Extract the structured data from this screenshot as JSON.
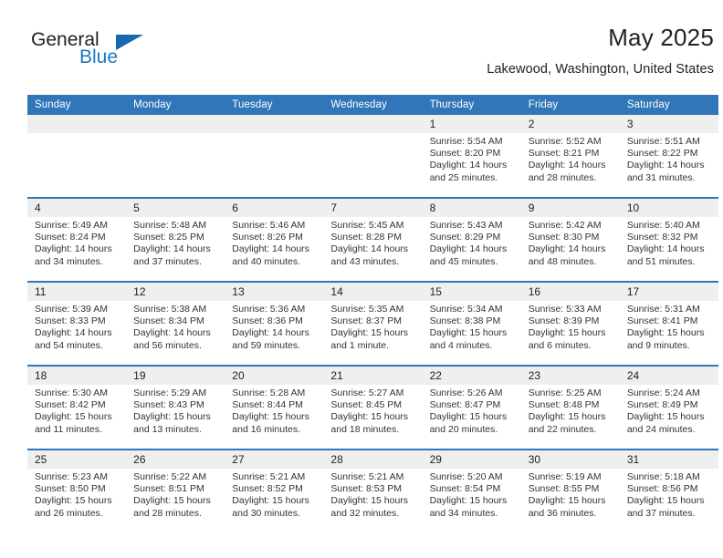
{
  "brand": {
    "name_part1": "General",
    "name_part2": "Blue",
    "triangle_color": "#1668b0",
    "blue_text_color": "#1b79c2"
  },
  "header": {
    "title": "May 2025",
    "location": "Lakewood, Washington, United States",
    "header_bg_color": "#3076b8",
    "daynum_bg_color": "#efefef"
  },
  "weekday_headers": [
    "Sunday",
    "Monday",
    "Tuesday",
    "Wednesday",
    "Thursday",
    "Friday",
    "Saturday"
  ],
  "labels": {
    "sunrise_prefix": "Sunrise:",
    "sunset_prefix": "Sunset:",
    "daylight_prefix": "Daylight:"
  },
  "weeks": [
    [
      {
        "day": "",
        "empty": true
      },
      {
        "day": "",
        "empty": true
      },
      {
        "day": "",
        "empty": true
      },
      {
        "day": "",
        "empty": true
      },
      {
        "day": "1",
        "sunrise": "Sunrise: 5:54 AM",
        "sunset": "Sunset: 8:20 PM",
        "daylight_line1": "Daylight: 14 hours",
        "daylight_line2": "and 25 minutes."
      },
      {
        "day": "2",
        "sunrise": "Sunrise: 5:52 AM",
        "sunset": "Sunset: 8:21 PM",
        "daylight_line1": "Daylight: 14 hours",
        "daylight_line2": "and 28 minutes."
      },
      {
        "day": "3",
        "sunrise": "Sunrise: 5:51 AM",
        "sunset": "Sunset: 8:22 PM",
        "daylight_line1": "Daylight: 14 hours",
        "daylight_line2": "and 31 minutes."
      }
    ],
    [
      {
        "day": "4",
        "sunrise": "Sunrise: 5:49 AM",
        "sunset": "Sunset: 8:24 PM",
        "daylight_line1": "Daylight: 14 hours",
        "daylight_line2": "and 34 minutes."
      },
      {
        "day": "5",
        "sunrise": "Sunrise: 5:48 AM",
        "sunset": "Sunset: 8:25 PM",
        "daylight_line1": "Daylight: 14 hours",
        "daylight_line2": "and 37 minutes."
      },
      {
        "day": "6",
        "sunrise": "Sunrise: 5:46 AM",
        "sunset": "Sunset: 8:26 PM",
        "daylight_line1": "Daylight: 14 hours",
        "daylight_line2": "and 40 minutes."
      },
      {
        "day": "7",
        "sunrise": "Sunrise: 5:45 AM",
        "sunset": "Sunset: 8:28 PM",
        "daylight_line1": "Daylight: 14 hours",
        "daylight_line2": "and 43 minutes."
      },
      {
        "day": "8",
        "sunrise": "Sunrise: 5:43 AM",
        "sunset": "Sunset: 8:29 PM",
        "daylight_line1": "Daylight: 14 hours",
        "daylight_line2": "and 45 minutes."
      },
      {
        "day": "9",
        "sunrise": "Sunrise: 5:42 AM",
        "sunset": "Sunset: 8:30 PM",
        "daylight_line1": "Daylight: 14 hours",
        "daylight_line2": "and 48 minutes."
      },
      {
        "day": "10",
        "sunrise": "Sunrise: 5:40 AM",
        "sunset": "Sunset: 8:32 PM",
        "daylight_line1": "Daylight: 14 hours",
        "daylight_line2": "and 51 minutes."
      }
    ],
    [
      {
        "day": "11",
        "sunrise": "Sunrise: 5:39 AM",
        "sunset": "Sunset: 8:33 PM",
        "daylight_line1": "Daylight: 14 hours",
        "daylight_line2": "and 54 minutes."
      },
      {
        "day": "12",
        "sunrise": "Sunrise: 5:38 AM",
        "sunset": "Sunset: 8:34 PM",
        "daylight_line1": "Daylight: 14 hours",
        "daylight_line2": "and 56 minutes."
      },
      {
        "day": "13",
        "sunrise": "Sunrise: 5:36 AM",
        "sunset": "Sunset: 8:36 PM",
        "daylight_line1": "Daylight: 14 hours",
        "daylight_line2": "and 59 minutes."
      },
      {
        "day": "14",
        "sunrise": "Sunrise: 5:35 AM",
        "sunset": "Sunset: 8:37 PM",
        "daylight_line1": "Daylight: 15 hours",
        "daylight_line2": "and 1 minute."
      },
      {
        "day": "15",
        "sunrise": "Sunrise: 5:34 AM",
        "sunset": "Sunset: 8:38 PM",
        "daylight_line1": "Daylight: 15 hours",
        "daylight_line2": "and 4 minutes."
      },
      {
        "day": "16",
        "sunrise": "Sunrise: 5:33 AM",
        "sunset": "Sunset: 8:39 PM",
        "daylight_line1": "Daylight: 15 hours",
        "daylight_line2": "and 6 minutes."
      },
      {
        "day": "17",
        "sunrise": "Sunrise: 5:31 AM",
        "sunset": "Sunset: 8:41 PM",
        "daylight_line1": "Daylight: 15 hours",
        "daylight_line2": "and 9 minutes."
      }
    ],
    [
      {
        "day": "18",
        "sunrise": "Sunrise: 5:30 AM",
        "sunset": "Sunset: 8:42 PM",
        "daylight_line1": "Daylight: 15 hours",
        "daylight_line2": "and 11 minutes."
      },
      {
        "day": "19",
        "sunrise": "Sunrise: 5:29 AM",
        "sunset": "Sunset: 8:43 PM",
        "daylight_line1": "Daylight: 15 hours",
        "daylight_line2": "and 13 minutes."
      },
      {
        "day": "20",
        "sunrise": "Sunrise: 5:28 AM",
        "sunset": "Sunset: 8:44 PM",
        "daylight_line1": "Daylight: 15 hours",
        "daylight_line2": "and 16 minutes."
      },
      {
        "day": "21",
        "sunrise": "Sunrise: 5:27 AM",
        "sunset": "Sunset: 8:45 PM",
        "daylight_line1": "Daylight: 15 hours",
        "daylight_line2": "and 18 minutes."
      },
      {
        "day": "22",
        "sunrise": "Sunrise: 5:26 AM",
        "sunset": "Sunset: 8:47 PM",
        "daylight_line1": "Daylight: 15 hours",
        "daylight_line2": "and 20 minutes."
      },
      {
        "day": "23",
        "sunrise": "Sunrise: 5:25 AM",
        "sunset": "Sunset: 8:48 PM",
        "daylight_line1": "Daylight: 15 hours",
        "daylight_line2": "and 22 minutes."
      },
      {
        "day": "24",
        "sunrise": "Sunrise: 5:24 AM",
        "sunset": "Sunset: 8:49 PM",
        "daylight_line1": "Daylight: 15 hours",
        "daylight_line2": "and 24 minutes."
      }
    ],
    [
      {
        "day": "25",
        "sunrise": "Sunrise: 5:23 AM",
        "sunset": "Sunset: 8:50 PM",
        "daylight_line1": "Daylight: 15 hours",
        "daylight_line2": "and 26 minutes."
      },
      {
        "day": "26",
        "sunrise": "Sunrise: 5:22 AM",
        "sunset": "Sunset: 8:51 PM",
        "daylight_line1": "Daylight: 15 hours",
        "daylight_line2": "and 28 minutes."
      },
      {
        "day": "27",
        "sunrise": "Sunrise: 5:21 AM",
        "sunset": "Sunset: 8:52 PM",
        "daylight_line1": "Daylight: 15 hours",
        "daylight_line2": "and 30 minutes."
      },
      {
        "day": "28",
        "sunrise": "Sunrise: 5:21 AM",
        "sunset": "Sunset: 8:53 PM",
        "daylight_line1": "Daylight: 15 hours",
        "daylight_line2": "and 32 minutes."
      },
      {
        "day": "29",
        "sunrise": "Sunrise: 5:20 AM",
        "sunset": "Sunset: 8:54 PM",
        "daylight_line1": "Daylight: 15 hours",
        "daylight_line2": "and 34 minutes."
      },
      {
        "day": "30",
        "sunrise": "Sunrise: 5:19 AM",
        "sunset": "Sunset: 8:55 PM",
        "daylight_line1": "Daylight: 15 hours",
        "daylight_line2": "and 36 minutes."
      },
      {
        "day": "31",
        "sunrise": "Sunrise: 5:18 AM",
        "sunset": "Sunset: 8:56 PM",
        "daylight_line1": "Daylight: 15 hours",
        "daylight_line2": "and 37 minutes."
      }
    ]
  ]
}
